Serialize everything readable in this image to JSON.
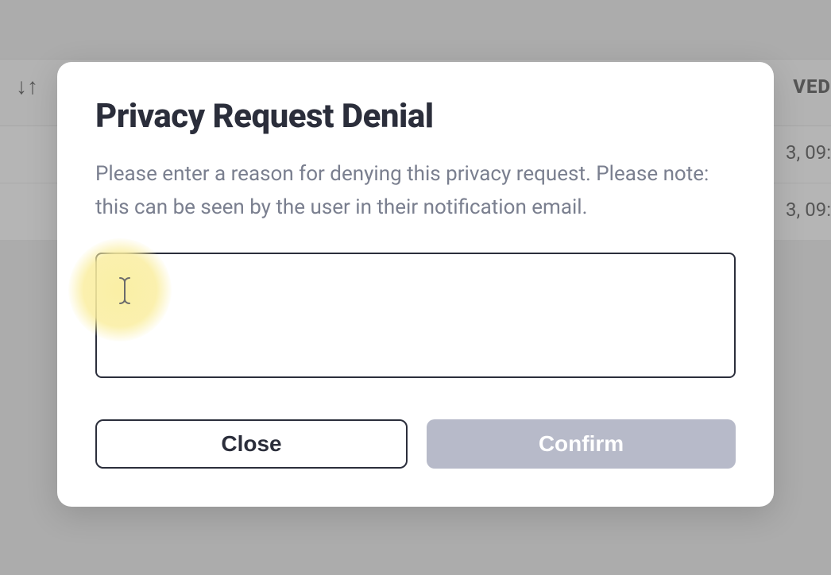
{
  "background": {
    "sort_icon": "↓↑",
    "header_right_fragment": "VED",
    "row1_right_fragment": "3, 09:",
    "row2_right_fragment": "3, 09:"
  },
  "modal": {
    "title": "Privacy Request Denial",
    "description": "Please enter a reason for denying this privacy request. Please note: this can be seen by the user in their notification email.",
    "reason_value": "",
    "close_label": "Close",
    "confirm_label": "Confirm"
  }
}
